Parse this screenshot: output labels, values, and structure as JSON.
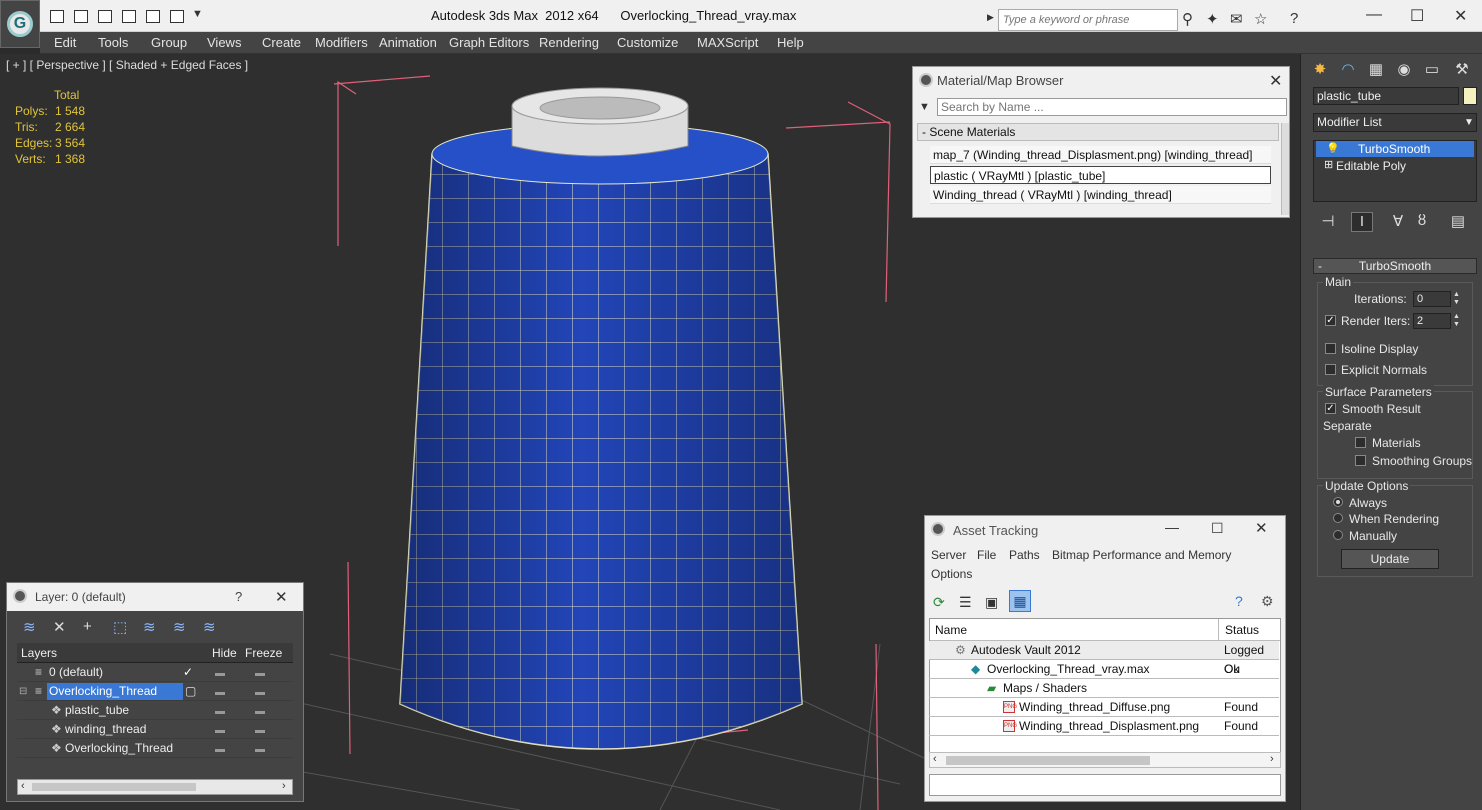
{
  "window": {
    "title": "Autodesk 3ds Max  2012 x64      Overlocking_Thread_vray.max",
    "search_placeholder": "Type a keyword or phrase"
  },
  "menu": [
    "Edit",
    "Tools",
    "Group",
    "Views",
    "Create",
    "Modifiers",
    "Animation",
    "Graph Editors",
    "Rendering",
    "Customize",
    "MAXScript",
    "Help"
  ],
  "viewport": {
    "label": "[ + ] [ Perspective ] [ Shaded + Edged Faces ]",
    "stats": {
      "header": "Total",
      "polys_label": "Polys:",
      "polys": "1 548",
      "tris_label": "Tris:",
      "tris": "2 664",
      "edges_label": "Edges:",
      "edges": "3 564",
      "verts_label": "Verts:",
      "verts": "1 368"
    }
  },
  "material_browser": {
    "title": "Material/Map Browser",
    "search_placeholder": "Search by Name ...",
    "section": "- Scene Materials",
    "items": [
      "map_7 (Winding_thread_Displasment.png) [winding_thread]",
      "plastic  ( VRayMtl )  [plastic_tube]",
      "Winding_thread  ( VRayMtl ) [winding_thread]"
    ]
  },
  "command_panel": {
    "object_name": "plastic_tube",
    "modifier_list": "Modifier List",
    "stack": [
      "TurboSmooth",
      "Editable Poly"
    ],
    "rollout_title": "TurboSmooth",
    "main_label": "Main",
    "iterations_label": "Iterations:",
    "iterations": "0",
    "render_iters_label": "Render Iters:",
    "render_iters": "2",
    "isoline": "Isoline Display",
    "explicit_normals": "Explicit Normals",
    "surface_params": "Surface Parameters",
    "smooth_result": "Smooth Result",
    "separate": "Separate",
    "materials": "Materials",
    "smoothing_groups": "Smoothing Groups",
    "update_options": "Update Options",
    "always": "Always",
    "when_rendering": "When Rendering",
    "manually": "Manually",
    "update_button": "Update"
  },
  "layer_dialog": {
    "title": "Layer: 0 (default)",
    "help": "?",
    "col_layers": "Layers",
    "col_hide": "Hide",
    "col_freeze": "Freeze",
    "rows": [
      "0 (default)",
      "Overlocking_Thread",
      "plastic_tube",
      "winding_thread",
      "Overlocking_Thread"
    ]
  },
  "asset_tracking": {
    "title": "Asset Tracking",
    "menu": [
      "Server",
      "File",
      "Paths",
      "Bitmap Performance and Memory",
      "Options"
    ],
    "col_name": "Name",
    "col_status": "Status",
    "rows": [
      {
        "name": "Autodesk Vault 2012",
        "status": "Logged Ou"
      },
      {
        "name": "Overlocking_Thread_vray.max",
        "status": "Ok"
      },
      {
        "name": "Maps / Shaders",
        "status": ""
      },
      {
        "name": "Winding_thread_Diffuse.png",
        "status": "Found"
      },
      {
        "name": "Winding_thread_Displasment.png",
        "status": "Found"
      }
    ]
  },
  "colors": {
    "viewport_bg": "#2f2f2f",
    "thread_blue": "#2245b8",
    "wire": "#e8e8c8",
    "stats_yellow": "#e0c43a",
    "selection_blue": "#3a78d6",
    "bbox_pink": "#e0607a"
  }
}
